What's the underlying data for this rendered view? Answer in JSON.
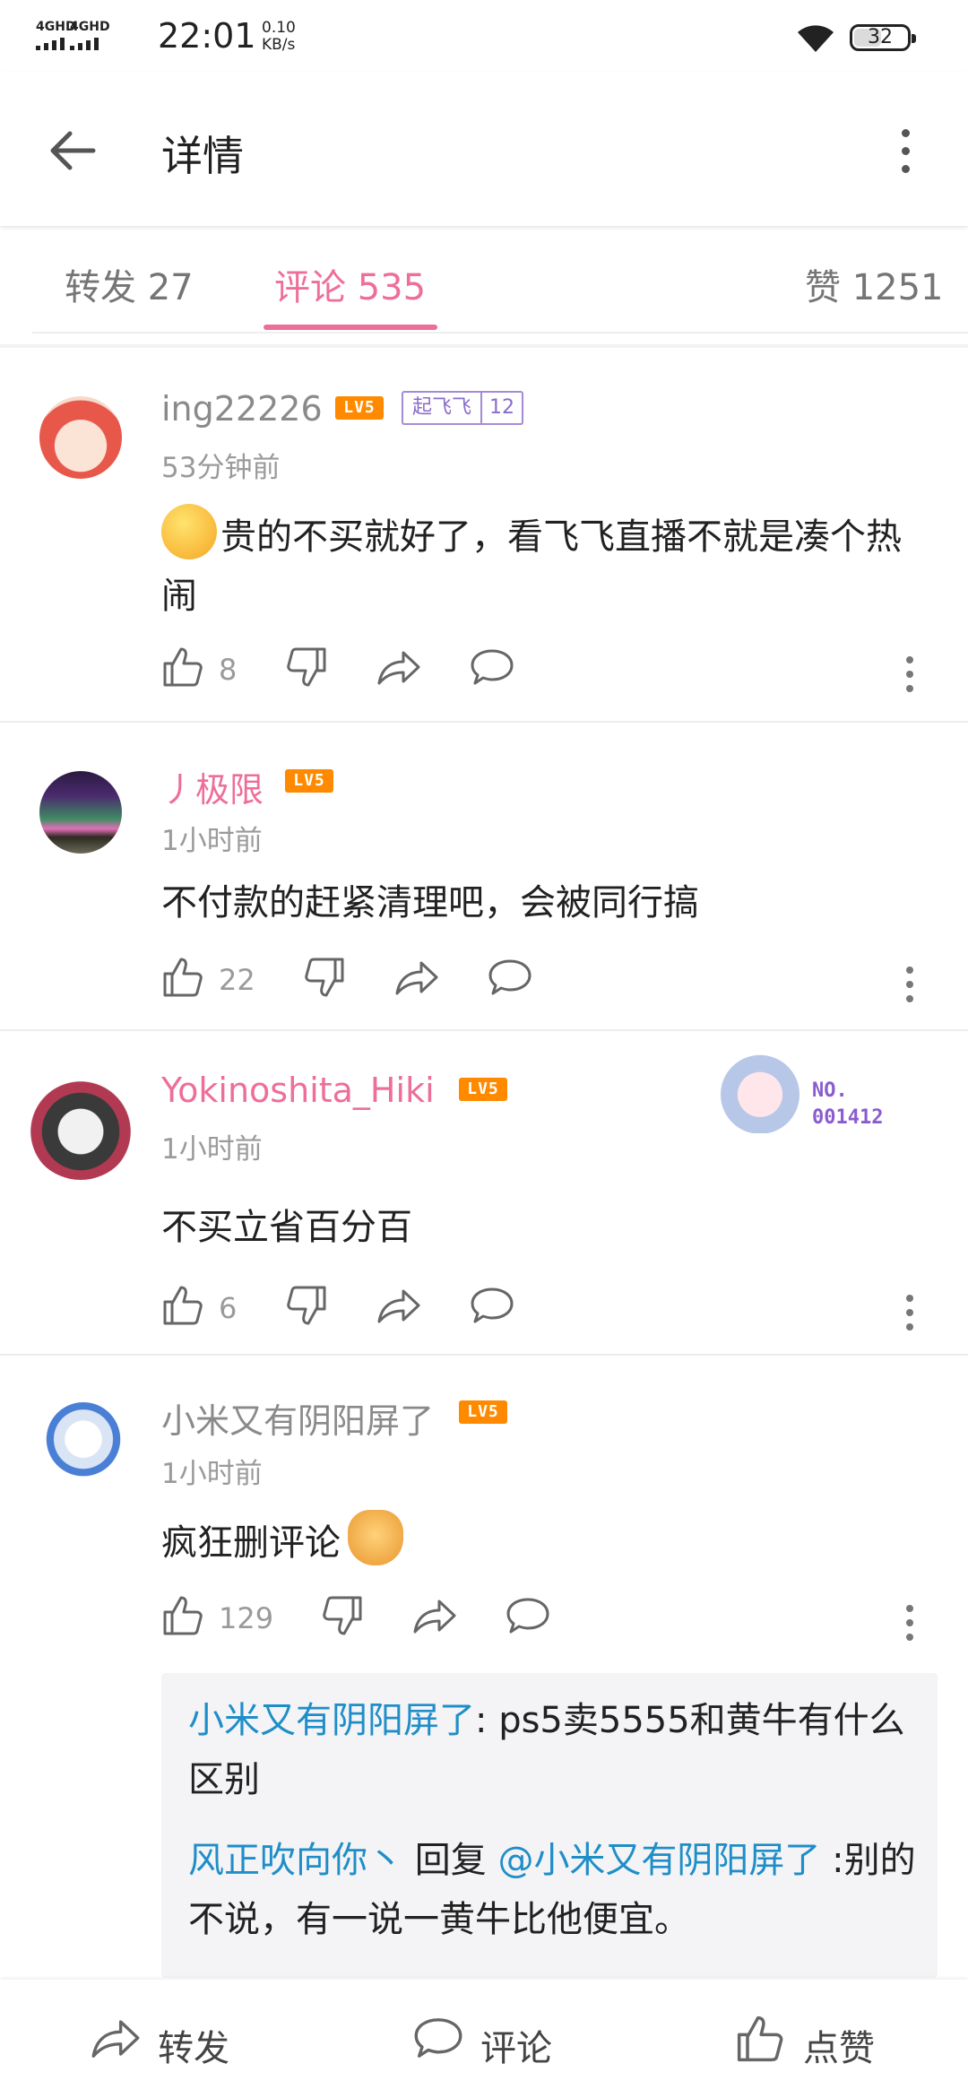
{
  "status": {
    "network1": "4GHD",
    "network2": "4GHD",
    "time": "22:01",
    "speed_value": "0.10",
    "speed_unit": "KB/s",
    "battery": "32"
  },
  "appbar": {
    "title": "详情"
  },
  "tabs": {
    "repost": "转发 27",
    "comment": "评论 535",
    "like": "赞 1251"
  },
  "comments": [
    {
      "user": "ing22226",
      "level": "LV5",
      "medal_name": "起飞飞",
      "medal_level": "12",
      "time": "53分钟前",
      "text": "贵的不买就好了，看飞飞直播不就是凑个热闹",
      "likes": "8"
    },
    {
      "user": "丿极限",
      "level": "LV5",
      "time": "1小时前",
      "text": "不付款的赶紧清理吧，会被同行搞",
      "likes": "22"
    },
    {
      "user": "Yokinoshita_Hiki",
      "level": "LV5",
      "time": "1小时前",
      "text": "不买立省百分百",
      "likes": "6",
      "badge_no": "NO.",
      "badge_num": "001412"
    },
    {
      "user": "小米又有阴阳屏了",
      "level": "LV5",
      "time": "1小时前",
      "text": "疯狂删评论",
      "likes": "129",
      "replies": [
        {
          "author": "小米又有阴阳屏了",
          "sep": ": ",
          "text": "ps5卖5555和黄牛有什么区别"
        },
        {
          "author": "风正吹向你丶",
          "mid": " 回复 ",
          "target": "@小米又有阴阳屏了",
          "sep": " :",
          "text": "别的不说，有一说一黄牛比他便宜。"
        }
      ]
    }
  ],
  "bottombar": {
    "repost": "转发",
    "comment": "评论",
    "like": "点赞"
  },
  "colors": {
    "accent": "#ee6e9b",
    "link": "#1f8ec8",
    "level_badge": "#ff8a00"
  }
}
